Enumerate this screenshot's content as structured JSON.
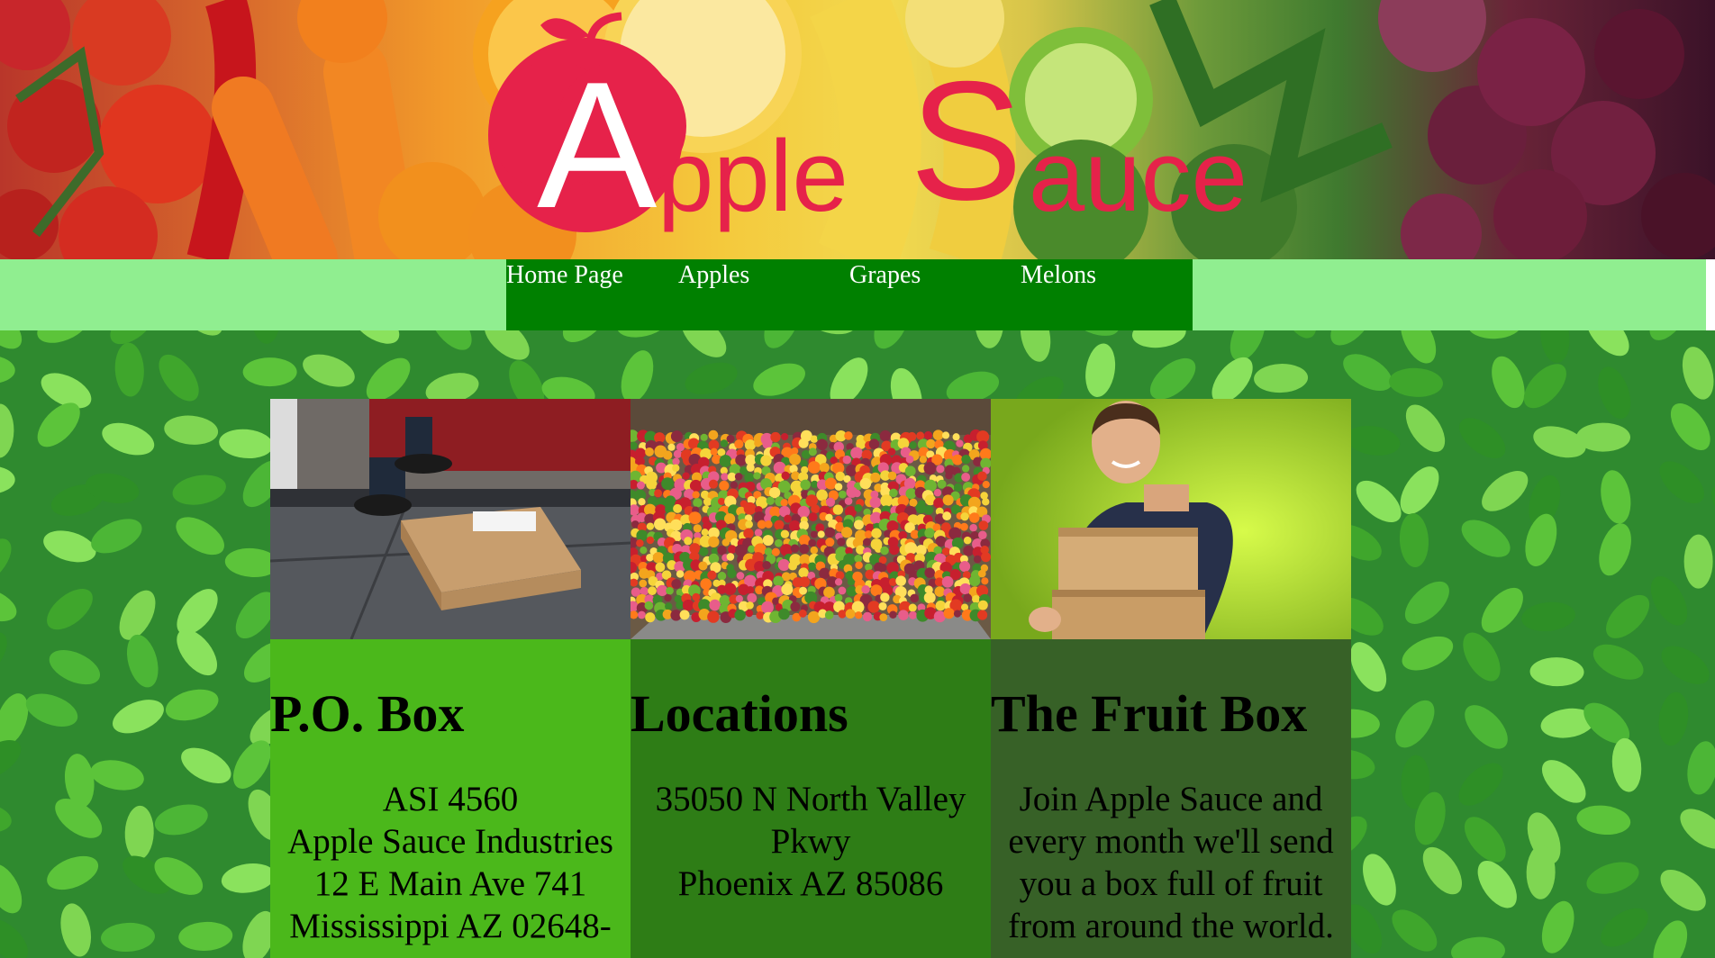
{
  "header": {
    "logo_letter": "A",
    "logo_word_1": "pple",
    "logo_word_2_initial": "S",
    "logo_word_2_rest": "auce",
    "brand_color": "#e6224a"
  },
  "nav": {
    "items": [
      {
        "label": "Home Page"
      },
      {
        "label": "Apples"
      },
      {
        "label": "Grapes"
      },
      {
        "label": "Melons"
      }
    ],
    "bar_color": "#90ee90",
    "inner_color": "#008000"
  },
  "cards": [
    {
      "title": "P.O. Box",
      "lines": [
        "ASI 4560",
        "Apple Sauce Industries",
        "12 E Main Ave 741",
        "Mississippi AZ 02648-"
      ],
      "body_color": "#4bb81b",
      "image": "package-on-doorstep"
    },
    {
      "title": "Locations",
      "lines": [
        "35050 N North Valley",
        "Pkwy",
        "Phoenix AZ 85086"
      ],
      "body_color": "#2e7d16",
      "image": "fruit-market-stall"
    },
    {
      "title": "The Fruit Box",
      "lines": [
        "Join Apple Sauce and",
        "every month we'll send",
        "you a box full of fruit",
        "from around the world."
      ],
      "body_color": "#376127",
      "image": "man-holding-boxes"
    }
  ]
}
